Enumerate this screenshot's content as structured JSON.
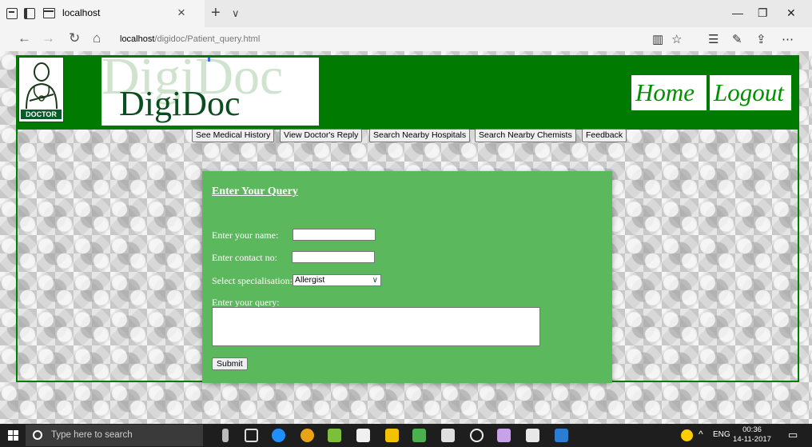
{
  "browser": {
    "tab_title": "localhost",
    "url_host": "localhost",
    "url_path": "/digidoc/Patient_query.html"
  },
  "header": {
    "logo_tag": "DOCTOR",
    "brand_ghost": "DigiDoc",
    "brand": "DigiDoc",
    "home": "Home",
    "logout": "Logout"
  },
  "menu": {
    "items": [
      "See Medical History",
      "View Doctor's Reply",
      "Search Nearby Hospitals",
      "Search Nearby Chemists",
      "Feedback"
    ]
  },
  "form": {
    "title": "Enter Your Query",
    "name_label": "Enter your name:",
    "contact_label": "Enter contact no:",
    "specialisation_label": "Select specialisation:",
    "specialisation_value": "Allergist",
    "query_label": "Enter your query:",
    "submit": "Submit"
  },
  "taskbar": {
    "search_placeholder": "Type here to search",
    "lang": "ENG",
    "time": "00:36",
    "date": "14-11-2017"
  },
  "colors": {
    "header_green": "#007a00",
    "card_green": "#5cb85c",
    "link_green": "#009000"
  }
}
